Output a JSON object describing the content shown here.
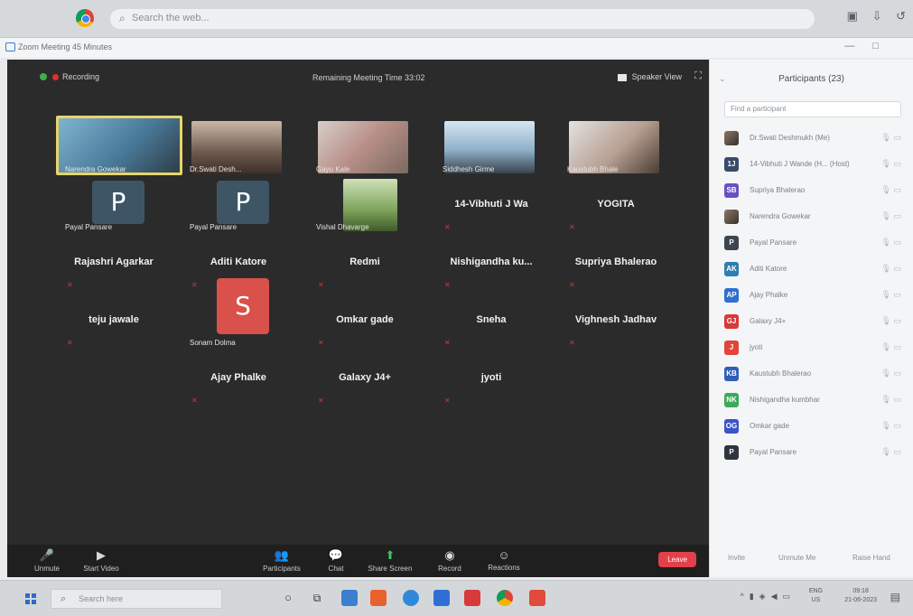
{
  "browser": {
    "search_placeholder": "Search the web...",
    "icons": [
      "chrome-icon",
      "search-icon",
      "profile-icon",
      "download-icon",
      "history-icon"
    ]
  },
  "zoom_window": {
    "title": "Zoom Meeting 45 Minutes",
    "controls": [
      "—",
      "□"
    ]
  },
  "meeting": {
    "recording_label": "Recording",
    "remaining_time": "Remaining Meeting Time 33:02",
    "speaker_view": "Speaker View",
    "rows": [
      [
        {
          "type": "video",
          "name": "Narendra Gowekar",
          "highlight": true
        },
        {
          "type": "video",
          "name": "Dr.Swati Desh..."
        },
        {
          "type": "video",
          "name": "Gayu Kale"
        },
        {
          "type": "video",
          "name": "Siddhesh Girme"
        },
        {
          "type": "video",
          "name": "Kaustubh Bhale"
        }
      ],
      [
        {
          "type": "avatar",
          "letter": "P",
          "name": "Payal Pansare"
        },
        {
          "type": "avatar",
          "letter": "P",
          "name": "Payal Pansare"
        },
        {
          "type": "video",
          "name": "Vishal Dhavarge"
        },
        {
          "type": "plain",
          "name": "14-Vibhuti J Wa"
        },
        {
          "type": "plain",
          "name": "YOGITA"
        }
      ],
      [
        {
          "type": "plain",
          "name": "Rajashri Agarkar"
        },
        {
          "type": "plain",
          "name": "Aditi Katore"
        },
        {
          "type": "plain",
          "name": "Redmi"
        },
        {
          "type": "plain",
          "name": "Nishigandha ku..."
        },
        {
          "type": "plain",
          "name": "Supriya Bhalerao"
        }
      ],
      [
        {
          "type": "plain",
          "name": "teju jawale"
        },
        {
          "type": "avatar",
          "letter": "S",
          "name": "Sonam Dolma"
        },
        {
          "type": "plain",
          "name": "Omkar gade"
        },
        {
          "type": "plain",
          "name": "Sneha"
        },
        {
          "type": "plain",
          "name": "Vighnesh Jadhav"
        }
      ],
      [
        {
          "type": "empty",
          "name": ""
        },
        {
          "type": "plain",
          "name": "Ajay Phalke"
        },
        {
          "type": "plain",
          "name": "Galaxy J4+"
        },
        {
          "type": "plain",
          "name": "jyoti"
        },
        {
          "type": "empty",
          "name": ""
        }
      ]
    ],
    "toolbar": {
      "unmute": "Unmute",
      "start_video": "Start Video",
      "participants": "Participants",
      "chat": "Chat",
      "share_screen": "Share Screen",
      "record": "Record",
      "reactions": "Reactions",
      "leave": "Leave"
    }
  },
  "panel": {
    "title": "Participants (23)",
    "search_placeholder": "Find a participant",
    "participants": [
      {
        "initials": "",
        "name": "Dr.Swati Deshmukh (Me)",
        "color": "#3b3b3b",
        "photo": true
      },
      {
        "initials": "1J",
        "name": "14-Vibhuti J Wande (H... (Host)",
        "color": "#394a6b"
      },
      {
        "initials": "SB",
        "name": "Supriya Bhalerao",
        "color": "#6b4fc3"
      },
      {
        "initials": "",
        "name": "Narendra Gowekar",
        "color": "#8c7a66",
        "photo": true
      },
      {
        "initials": "P",
        "name": "Payal Pansare",
        "color": "#3d4650"
      },
      {
        "initials": "AK",
        "name": "Aditi Katore",
        "color": "#2f7fb0"
      },
      {
        "initials": "AP",
        "name": "Ajay Phalke",
        "color": "#2f6fd0"
      },
      {
        "initials": "GJ",
        "name": "Galaxy J4+",
        "color": "#d8393a"
      },
      {
        "initials": "J",
        "name": "jyoti",
        "color": "#e0443a"
      },
      {
        "initials": "KB",
        "name": "Kaustubh Bhalerao",
        "color": "#2f5fb8"
      },
      {
        "initials": "NK",
        "name": "Nishigandha kumbhar",
        "color": "#3caa5a"
      },
      {
        "initials": "OG",
        "name": "Omkar gade",
        "color": "#3a55c8"
      },
      {
        "initials": "P",
        "name": "Payal Pansare",
        "color": "#2f3540"
      }
    ],
    "footer": {
      "invite": "Invite",
      "unmute_me": "Unmute Me",
      "raise_hand": "Raise Hand"
    }
  },
  "taskbar": {
    "search_placeholder": "Search here",
    "lang": "ENG",
    "region": "US",
    "time": "09:18",
    "date": "21-06-2023"
  }
}
